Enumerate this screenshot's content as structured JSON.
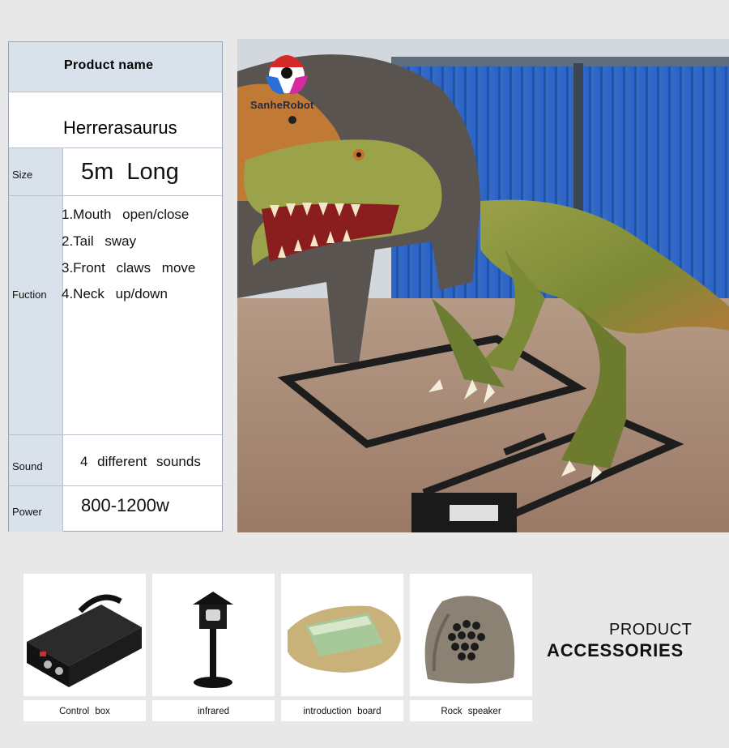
{
  "brand": {
    "logo_text": "SanheRobot"
  },
  "spec_table": {
    "header": "Product name",
    "product_name": "Herrerasaurus",
    "size": {
      "label": "Size",
      "value": "5m Long"
    },
    "function": {
      "label": "Fuction",
      "items": [
        "1.Mouth open/close",
        "2.Tail sway",
        "3.Front claws move",
        "4.Neck up/down"
      ]
    },
    "sound": {
      "label": "Sound",
      "value": "4 different sounds"
    },
    "power": {
      "label": "Power",
      "value": "800-1200w"
    }
  },
  "accessories": {
    "heading_top": "PRODUCT",
    "heading_bottom": "ACCESSORIES",
    "items": [
      {
        "label": "Control box",
        "icon": "control-box-icon"
      },
      {
        "label": "infrared",
        "icon": "infrared-sensor-icon"
      },
      {
        "label": "introduction board",
        "icon": "introduction-board-icon"
      },
      {
        "label": "Rock speaker",
        "icon": "rock-speaker-icon"
      }
    ]
  },
  "colors": {
    "table_label_bg": "#d9e1eb",
    "page_bg": "#e8e8e8",
    "wall_blue": "#2f6fc4",
    "dino_green": "#7f8f3a"
  }
}
